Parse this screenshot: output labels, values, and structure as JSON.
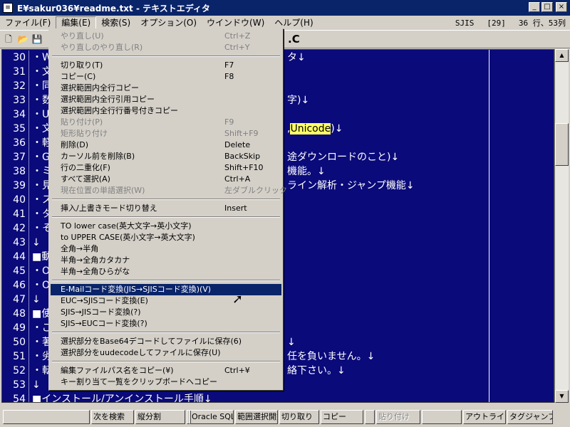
{
  "window": {
    "title": "E¥sakur036¥readme.txt - テキストエディタ"
  },
  "menubar": {
    "items": [
      "ファイル(F)",
      "編集(E)",
      "検索(S)",
      "オプション(O)",
      "ウインドウ(W)",
      "ヘルプ(H)"
    ],
    "encoding": "SJIS",
    "mode": "[29]",
    "position": "36 行、53列"
  },
  "toolbar": {
    "tail_text": ".C"
  },
  "editor": {
    "lines": [
      {
        "num": "30",
        "text": "・W",
        "tail": "タ↓"
      },
      {
        "num": "31",
        "text": "・文",
        "tail": ""
      },
      {
        "num": "32",
        "text": "・同",
        "tail": ""
      },
      {
        "num": "33",
        "text": "・数",
        "tail": "字)↓"
      },
      {
        "num": "34",
        "text": "・U",
        "tail": ""
      },
      {
        "num": "35",
        "text": "・文",
        "tail": ",",
        "hl": "Unicode",
        "tail2": ")↓"
      },
      {
        "num": "36",
        "text": "・軽",
        "tail": ""
      },
      {
        "num": "37",
        "text": "・G",
        "tail": "途ダウンロードのこと)↓"
      },
      {
        "num": "38",
        "text": "・ミ",
        "tail": "機能。↓"
      },
      {
        "num": "39",
        "text": "・見",
        "tail": "ライン解析・ジャンプ機能↓"
      },
      {
        "num": "40",
        "text": "・ス",
        "tail": ""
      },
      {
        "num": "41",
        "text": "・タ",
        "tail": ""
      },
      {
        "num": "42",
        "text": "・そ",
        "tail": ""
      },
      {
        "num": "43",
        "text": "↓",
        "tail": ""
      },
      {
        "num": "44",
        "text": "■動",
        "tail": ""
      },
      {
        "num": "45",
        "text": "・O",
        "tail": ""
      },
      {
        "num": "46",
        "text": "・O",
        "tail": ""
      },
      {
        "num": "47",
        "text": "↓",
        "tail": ""
      },
      {
        "num": "48",
        "text": "■使",
        "tail": ""
      },
      {
        "num": "49",
        "text": "・ご",
        "tail": ""
      },
      {
        "num": "50",
        "text": "・著",
        "tail": "↓"
      },
      {
        "num": "51",
        "text": "・劣",
        "tail": "任を負いません。↓"
      },
      {
        "num": "52",
        "text": "・転",
        "tail": "絡下さい。↓"
      },
      {
        "num": "53",
        "text": "↓",
        "tail": ""
      },
      {
        "num": "54",
        "text": "■インストール/アンインストール手順↓",
        "tail": ""
      }
    ]
  },
  "edit_menu": {
    "items": [
      {
        "label": "やり直し(U)",
        "shortcut": "Ctrl+Z",
        "disabled": true
      },
      {
        "label": "やり直しのやり直し(R)",
        "shortcut": "Ctrl+Y",
        "disabled": true
      },
      {
        "sep": true
      },
      {
        "label": "切り取り(T)",
        "shortcut": "F7"
      },
      {
        "label": "コピー(C)",
        "shortcut": "F8"
      },
      {
        "label": "選択範囲内全行コピー",
        "shortcut": ""
      },
      {
        "label": "選択範囲内全行引用コピー",
        "shortcut": ""
      },
      {
        "label": "選択範囲内全行行番号付きコピー",
        "shortcut": ""
      },
      {
        "label": "貼り付け(P)",
        "shortcut": "F9",
        "disabled": true
      },
      {
        "label": "矩形貼り付け",
        "shortcut": "Shift+F9",
        "disabled": true
      },
      {
        "label": "削除(D)",
        "shortcut": "Delete"
      },
      {
        "label": "カーソル前を削除(B)",
        "shortcut": "BackSkip"
      },
      {
        "label": "行の二重化(F)",
        "shortcut": "Shift+F10"
      },
      {
        "label": "すべて選択(A)",
        "shortcut": "Ctrl+A"
      },
      {
        "label": "現在位置の単語選択(W)",
        "shortcut": "左ダブルクリック",
        "disabled": true
      },
      {
        "sep": true
      },
      {
        "label": "挿入/上書きモード切り替え",
        "shortcut": "Insert"
      },
      {
        "sep": true
      },
      {
        "label": "TO lower case(英大文字→英小文字)",
        "shortcut": ""
      },
      {
        "label": "to UPPER CASE(英小文字→英大文字)",
        "shortcut": ""
      },
      {
        "label": "全角→半角",
        "shortcut": ""
      },
      {
        "label": "半角→全角カタカナ",
        "shortcut": ""
      },
      {
        "label": "半角→全角ひらがな",
        "shortcut": ""
      },
      {
        "sep": true
      },
      {
        "label": "E-Mailコード変換(JIS→SJISコード変換)(V)",
        "shortcut": "",
        "selected": true
      },
      {
        "label": "EUC→SJISコード変換(E)",
        "shortcut": ""
      },
      {
        "label": "SJIS→JISコード変換(?)",
        "shortcut": ""
      },
      {
        "label": "SJIS→EUCコード変換(?)",
        "shortcut": ""
      },
      {
        "sep": true
      },
      {
        "label": "選択部分をBase64デコードしてファイルに保存(6)",
        "shortcut": ""
      },
      {
        "label": "選択部分をuudecodeしてファイルに保存(U)",
        "shortcut": ""
      },
      {
        "sep": true
      },
      {
        "label": "編集ファイルパス名をコピー(¥)",
        "shortcut": "Ctrl+¥"
      },
      {
        "label": "キー割り当て一覧をクリップボードへコピー",
        "shortcut": ""
      }
    ]
  },
  "funcbar": {
    "keys": [
      {
        "label": "",
        "disabled": false
      },
      {
        "label": "次を検索",
        "disabled": false
      },
      {
        "label": "縦分割",
        "disabled": false
      },
      {
        "label": "",
        "disabled": false
      },
      {
        "label": "Oracle SQL",
        "disabled": false
      },
      {
        "label": "範囲選択開始",
        "disabled": false
      },
      {
        "label": "切り取り",
        "disabled": false
      },
      {
        "label": "コピー",
        "disabled": false
      },
      {
        "label": "",
        "disabled": false
      },
      {
        "label": "貼り付け",
        "disabled": true
      },
      {
        "label": "",
        "disabled": false
      },
      {
        "label": "アウトライン解析",
        "disabled": false
      },
      {
        "label": "タグジャンプ",
        "disabled": false
      }
    ]
  }
}
